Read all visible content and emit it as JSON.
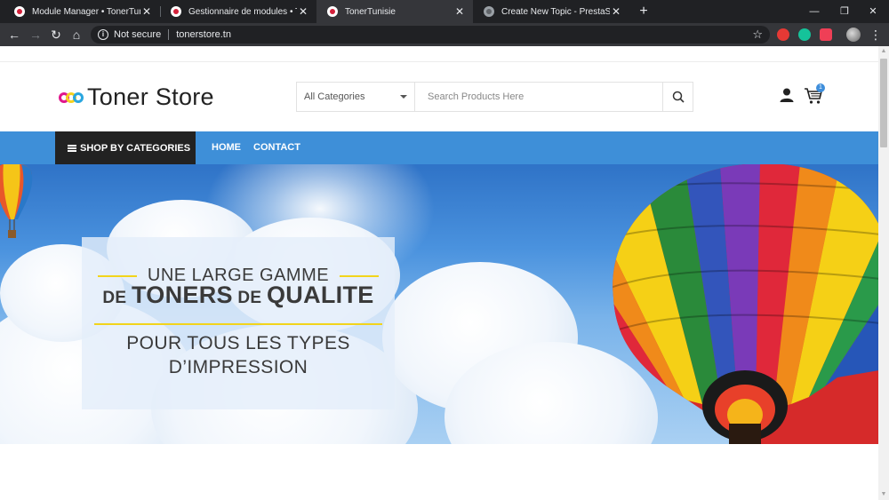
{
  "browser": {
    "tabs": [
      {
        "title": "Module Manager • TonerTunisie",
        "active": false
      },
      {
        "title": "Gestionnaire de modules • Toner",
        "active": false
      },
      {
        "title": "TonerTunisie",
        "active": true
      },
      {
        "title": "Create New Topic - PrestaShop F",
        "active": false
      }
    ],
    "new_tab": "+",
    "security_label": "Not secure",
    "url": "tonerstore.tn"
  },
  "site": {
    "logo_text": "Toner Store",
    "logo_colors": [
      "#e0178c",
      "#f7d11e",
      "#2aa6df"
    ],
    "search": {
      "category": "All Categories",
      "placeholder": "Search Products Here"
    },
    "cart_count": "1",
    "nav": {
      "categories_button": "SHOP BY CATEGORIES",
      "links": [
        "HOME",
        "CONTACT"
      ]
    },
    "accent_color": "#3e8fd8"
  },
  "hero": {
    "line1": "UNE LARGE GAMME",
    "line2_pre": "DE ",
    "line2_main1": "TONERS",
    "line2_mid": " DE ",
    "line2_main2": "QUALITE",
    "line3": "POUR TOUS LES TYPES",
    "line4": "D’IMPRESSION"
  }
}
